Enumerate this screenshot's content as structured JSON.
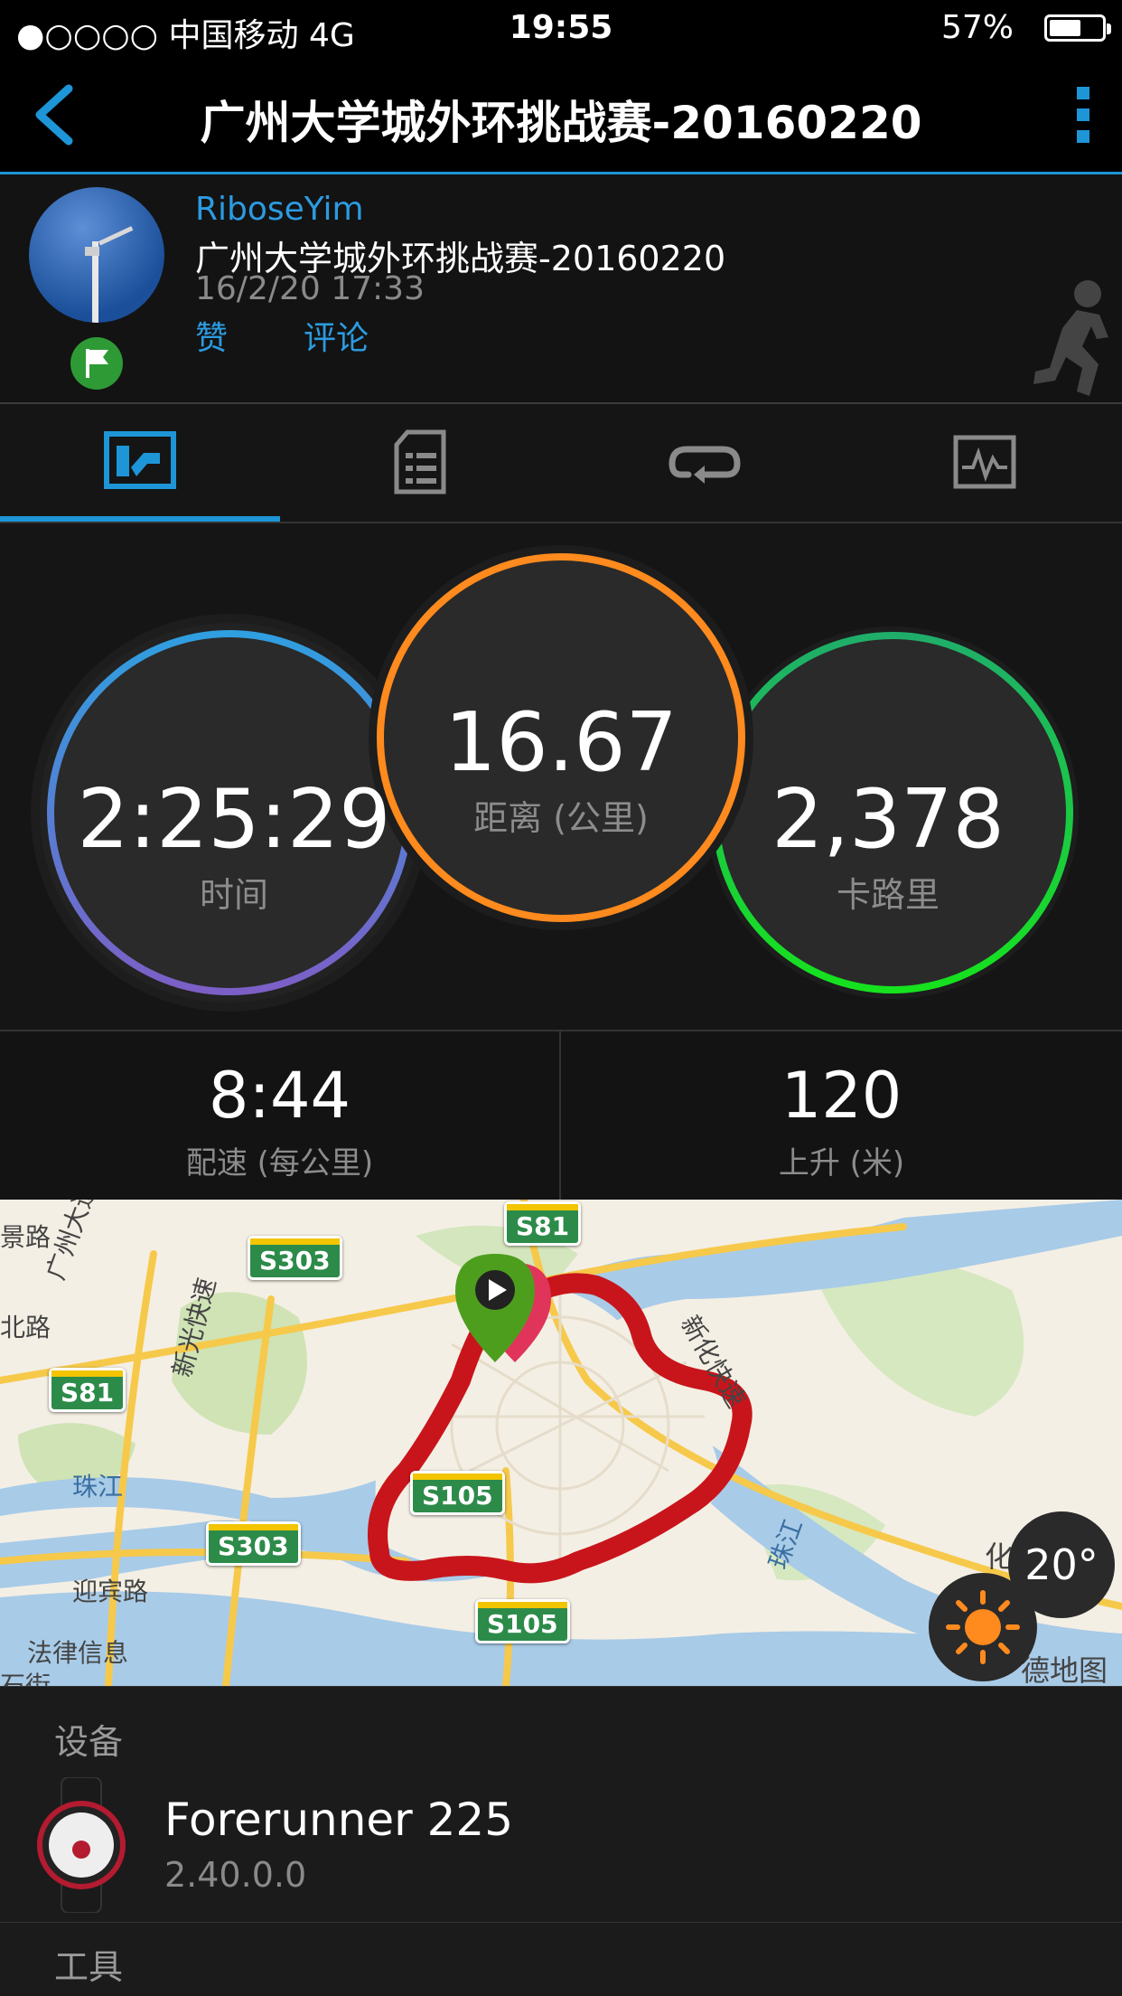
{
  "status_bar": {
    "carrier": "●○○○○ 中国移动   4G",
    "time": "19:55",
    "battery": "57%"
  },
  "nav": {
    "title": "广州大学城外环挑战赛-20160220"
  },
  "activity": {
    "user": "RiboseYim",
    "title": "广州大学城外环挑战赛-20160220",
    "date": "16/2/20 17:33",
    "like_label": "赞",
    "comment_label": "评论"
  },
  "tabs": [
    {
      "icon": "overview-icon"
    },
    {
      "icon": "details-icon"
    },
    {
      "icon": "laps-icon"
    },
    {
      "icon": "charts-icon"
    }
  ],
  "stats": {
    "time": {
      "value": "2:25:29",
      "label": "时间"
    },
    "distance": {
      "value": "16.67",
      "label": "距离 (公里)"
    },
    "calories": {
      "value": "2,378",
      "label": "卡路里"
    },
    "pace": {
      "value": "8:44",
      "label": "配速 (每公里)"
    },
    "ascent": {
      "value": "120",
      "label": "上升 (米)"
    }
  },
  "colors": {
    "accent": "#1d95d6",
    "time_ring_top": "#2f9fe0",
    "time_ring_bottom": "#7c5fc6",
    "distance_ring": "#ff8a1e",
    "calories_ring_top": "#1fae6a",
    "calories_ring_bottom": "#16e21e",
    "route": "#c8151b"
  },
  "map": {
    "shields": [
      "S81",
      "S303",
      "S81",
      "S105",
      "S303",
      "S105"
    ],
    "labels": [
      "景路",
      "广州大道",
      "新光快速",
      "北路",
      "珠江",
      "迎宾路",
      "法律信息",
      "石街",
      "新化快速",
      "珠江",
      "化",
      "德地图"
    ],
    "temperature": "20°"
  },
  "device_section": {
    "title": "设备",
    "name": "Forerunner 225",
    "version": "2.40.0.0"
  },
  "tools_section": {
    "title": "工具"
  }
}
